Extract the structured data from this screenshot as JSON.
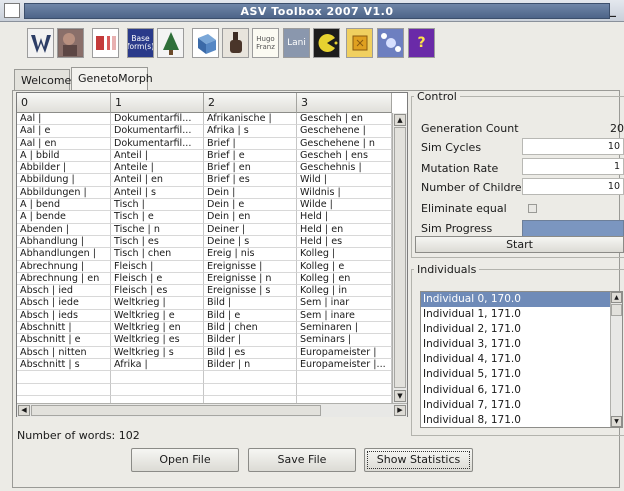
{
  "window": {
    "title": "ASV Toolbox 2007 V1.0",
    "minimize_glyph": "_"
  },
  "toolbar": {
    "buttons": [
      {
        "icon": "w-logo-icon",
        "text": ""
      },
      {
        "icon": "photo-icon",
        "text": ""
      },
      {
        "icon": "text-block-icon",
        "text": ""
      },
      {
        "icon": "baseform-icon",
        "text": "Base form(s)"
      },
      {
        "icon": "tree-icon",
        "text": ""
      },
      {
        "icon": "cube-icon",
        "text": ""
      },
      {
        "icon": "hand-icon",
        "text": ""
      },
      {
        "icon": "hugo-icon",
        "text": "Hugo Franz"
      },
      {
        "icon": "lani-icon",
        "text": "Lani"
      },
      {
        "icon": "pacman-icon",
        "text": ""
      },
      {
        "icon": "chip-icon",
        "text": ""
      },
      {
        "icon": "molecule-icon",
        "text": ""
      },
      {
        "icon": "question-icon",
        "text": "?"
      }
    ]
  },
  "tabs": [
    {
      "label": "Welcome",
      "active": false
    },
    {
      "label": "GenetoMorph",
      "active": true
    }
  ],
  "table": {
    "columns": [
      "0",
      "1",
      "2",
      "3"
    ],
    "rows": [
      [
        "Aal |",
        "Dokumentarfil...",
        "Afrikanische |",
        "Gescheh | en"
      ],
      [
        "Aal | e",
        "Dokumentarfil...",
        "Afrika | s",
        "Geschehene |"
      ],
      [
        "Aal | en",
        "Dokumentarfil...",
        "Brief |",
        "Geschehene | n"
      ],
      [
        "A | bbild",
        "Anteil |",
        "Brief | e",
        "Gescheh | ens"
      ],
      [
        "Abbilder |",
        "Anteile |",
        "Brief | en",
        "Geschehnis |"
      ],
      [
        "Abbildung |",
        "Anteil | en",
        "Brief | es",
        "Wild |"
      ],
      [
        "Abbildungen |",
        "Anteil | s",
        "Dein |",
        "Wildnis |"
      ],
      [
        "A | bend",
        "Tisch |",
        "Dein | e",
        "Wilde |"
      ],
      [
        "A | bende",
        "Tisch | e",
        "Dein | en",
        "Held |"
      ],
      [
        "Abenden |",
        "Tische | n",
        "Deiner |",
        "Held | en"
      ],
      [
        "Abhandlung |",
        "Tisch | es",
        "Deine | s",
        "Held | es"
      ],
      [
        "Abhandlungen |",
        "Tisch | chen",
        "Ereig | nis",
        "Kolleg |"
      ],
      [
        "Abrechnung |",
        "Fleisch |",
        "Ereignisse |",
        "Kolleg | e"
      ],
      [
        "Abrechnung | en",
        "Fleisch | e",
        "Ereignisse | n",
        "Kolleg | en"
      ],
      [
        "Absch | ied",
        "Fleisch | es",
        "Ereignisse | s",
        "Kolleg | in"
      ],
      [
        "Absch | iede",
        "Weltkrieg |",
        "Bild |",
        "Sem | inar"
      ],
      [
        "Absch | ieds",
        "Weltkrieg | e",
        "Bild | e",
        "Sem | inare"
      ],
      [
        "Abschnitt |",
        "Weltkrieg | en",
        "Bild | chen",
        "Seminaren |"
      ],
      [
        "Abschnitt | e",
        "Weltkrieg | es",
        "Bilder |",
        "Seminars |"
      ],
      [
        "Absch | nitten",
        "Weltkrieg | s",
        "Bild | es",
        "Europameister |"
      ],
      [
        "Abschnitt | s",
        "Afrika |",
        "Bilder | n",
        "Europameister |..."
      ],
      [
        "",
        "",
        "",
        ""
      ],
      [
        "",
        "",
        "",
        ""
      ],
      [
        "",
        "",
        "",
        ""
      ]
    ]
  },
  "status": {
    "word_count": "Number of words: 102"
  },
  "buttons": {
    "open": "Open File",
    "save": "Save File",
    "stats": "Show Statistics"
  },
  "control": {
    "legend": "Control",
    "generation_count_label": "Generation Count",
    "generation_count_value": "20",
    "sim_cycles_label": "Sim Cycles",
    "sim_cycles_value": "10",
    "mutation_rate_label": "Mutation Rate",
    "mutation_rate_value": "1",
    "children_label": "Number of Children",
    "children_value": "10",
    "eliminate_label": "Eliminate equal",
    "eliminate_checked": false,
    "progress_label": "Sim Progress",
    "progress_fraction": 1.0,
    "start_label": "Start"
  },
  "individuals": {
    "legend": "Individuals",
    "items": [
      "Individual 0, 170.0",
      "Individual 1, 171.0",
      "Individual 2, 171.0",
      "Individual 3, 171.0",
      "Individual 4, 171.0",
      "Individual 5, 171.0",
      "Individual 6, 171.0",
      "Individual 7, 171.0",
      "Individual 8, 171.0"
    ],
    "selected_index": 0
  },
  "colors": {
    "title": "#5a7196",
    "selection": "#6f8bb8",
    "progress": "#7b96c0"
  }
}
